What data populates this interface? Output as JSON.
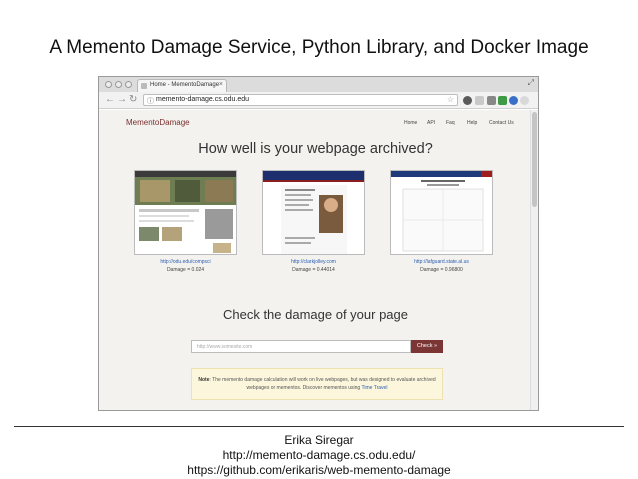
{
  "slide": {
    "title": "A Memento Damage Service, Python Library, and Docker Image",
    "author": "Erika Siregar",
    "link1": "http://memento-damage.cs.odu.edu/",
    "link2": "https://github.com/erikaris/web-memento-damage"
  },
  "browser": {
    "tab_title": "Home - MementoDamage",
    "url": "memento-damage.cs.odu.edu"
  },
  "site": {
    "brand": "MementoDamage",
    "nav": [
      "Home",
      "API",
      "Faq",
      "Help",
      "Contact Us"
    ],
    "headline": "How well is your webpage archived?",
    "examples": [
      {
        "url": "http://odu.edu/compsci",
        "damage": "Damage = 0.024"
      },
      {
        "url": "http://clarkjolley.com",
        "damage": "Damage = 0.44014"
      },
      {
        "url": "http://lafguard.state.al.us",
        "damage": "Damage = 0.96800"
      }
    ],
    "check_title": "Check the damage of your page",
    "input_placeholder": "http://www.somesite.com",
    "check_button": "Check »",
    "note_label": "Note",
    "note_text": ": The memento damage calculation will work on live webpages, but was designed to evaluate archived webpages or mementos. Discover mementos using",
    "note_link": "Time Travel"
  },
  "colors": {
    "brand": "#7a2f2f",
    "check_button": "#7b3535",
    "link": "#2a5db0",
    "note_bg": "#fcf6dc"
  }
}
